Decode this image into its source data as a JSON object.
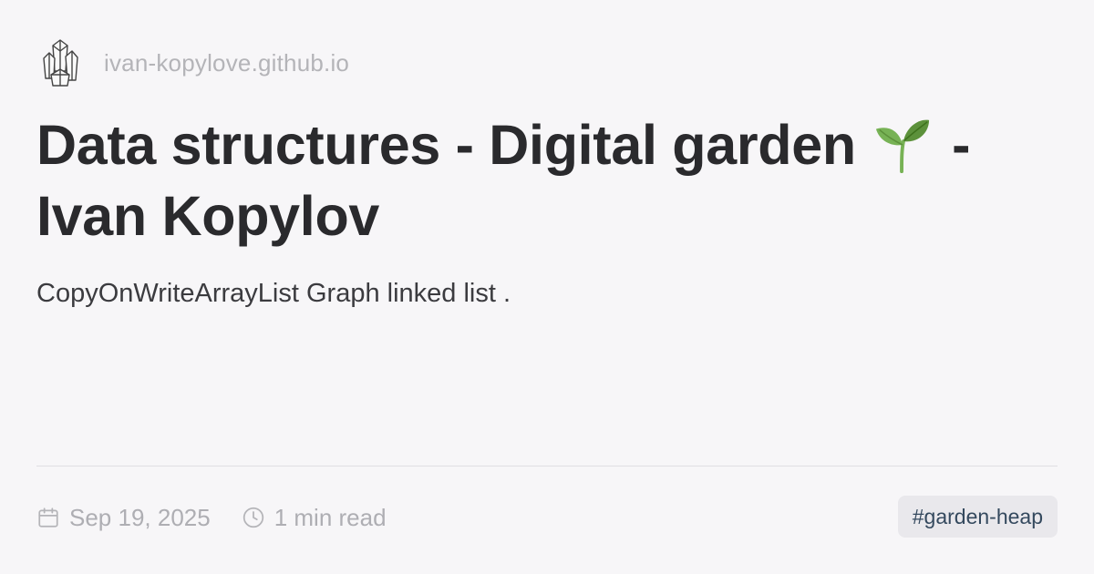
{
  "site": {
    "name": "ivan-kopylove.github.io",
    "logo_icon": "crystal-logo-icon"
  },
  "title": {
    "before_icon": "Data structures - Digital garden",
    "icon": "sprout-emoji-icon",
    "after_icon": "- Ivan Kopylov"
  },
  "description": "CopyOnWriteArrayList Graph linked list .",
  "meta": {
    "date": "Sep 19, 2025",
    "date_icon": "calendar-icon",
    "read_time": "1 min read",
    "read_time_icon": "clock-icon"
  },
  "tag": "#garden-heap",
  "colors": {
    "background": "#f7f6f8",
    "title": "#2a2a2d",
    "muted": "#aeaeb3",
    "tag_bg": "#e9e8ec",
    "tag_text": "#34495e"
  }
}
